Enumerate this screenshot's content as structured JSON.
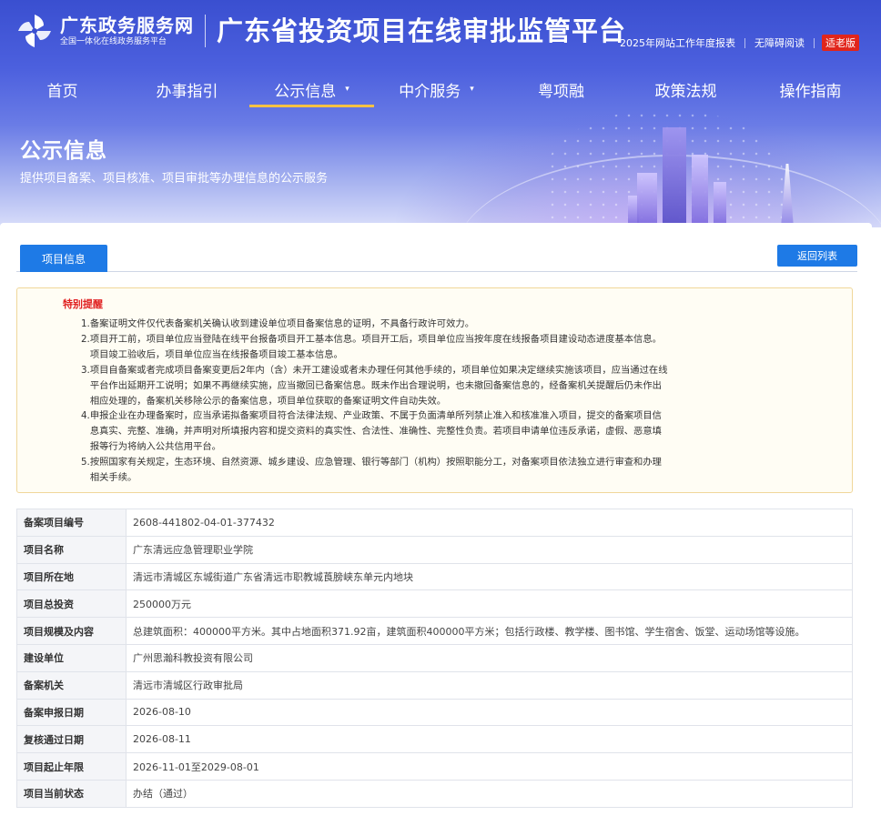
{
  "header": {
    "logo_name": "广东政务服务网",
    "logo_sub": "全国一体化在线政务服务平台",
    "platform_title": "广东省投资项目在线审批监管平台",
    "links": [
      "2025年网站工作年度报表",
      "无障碍阅读"
    ],
    "elder_label": "适老版"
  },
  "nav": {
    "items": [
      {
        "label": "首页",
        "has_dropdown": false
      },
      {
        "label": "办事指引",
        "has_dropdown": false
      },
      {
        "label": "公示信息",
        "has_dropdown": true,
        "active": true
      },
      {
        "label": "中介服务",
        "has_dropdown": true
      },
      {
        "label": "粤项融",
        "has_dropdown": false
      },
      {
        "label": "政策法规",
        "has_dropdown": false
      },
      {
        "label": "操作指南",
        "has_dropdown": false
      }
    ],
    "caret_icon": "▾"
  },
  "banner": {
    "title": "公示信息",
    "subtitle": "提供项目备案、项目核准、项目审批等办理信息的公示服务"
  },
  "tabs": {
    "active_label": "项目信息",
    "back_label": "返回列表"
  },
  "notice": {
    "title": "特别提醒",
    "items": [
      {
        "num": "1.",
        "lines": [
          "备案证明文件仅代表备案机关确认收到建设单位项目备案信息的证明，不具备行政许可效力。"
        ]
      },
      {
        "num": "2.",
        "lines": [
          "项目开工前，项目单位应当登陆在线平台报备项目开工基本信息。项目开工后，项目单位应当按年度在线报备项目建设动态进度基本信息。",
          "项目竣工验收后，项目单位应当在线报备项目竣工基本信息。"
        ]
      },
      {
        "num": "3.",
        "lines": [
          "项目自备案或者完成项目备案变更后2年内（含）未开工建设或者未办理任何其他手续的，项目单位如果决定继续实施该项目，应当通过在线",
          "平台作出延期开工说明；如果不再继续实施，应当撤回已备案信息。既未作出合理说明，也未撤回备案信息的，经备案机关提醒后仍未作出",
          "相应处理的，备案机关移除公示的备案信息，项目单位获取的备案证明文件自动失效。"
        ]
      },
      {
        "num": "4.",
        "lines": [
          "申报企业在办理备案时，应当承诺拟备案项目符合法律法规、产业政策、不属于负面清单所列禁止准入和核准准入项目，提交的备案项目信",
          "息真实、完整、准确，并声明对所填报内容和提交资料的真实性、合法性、准确性、完整性负责。若项目申请单位违反承诺，虚假、恶意填",
          "报等行为将纳入公共信用平台。"
        ]
      },
      {
        "num": "5.",
        "lines": [
          "按照国家有关规定，生态环境、自然资源、城乡建设、应急管理、银行等部门（机构）按照职能分工，对备案项目依法独立进行审查和办理",
          "相关手续。"
        ]
      }
    ]
  },
  "project": {
    "rows": [
      {
        "key": "备案项目编号",
        "value": "2608-441802-04-01-377432"
      },
      {
        "key": "项目名称",
        "value": "广东清远应急管理职业学院"
      },
      {
        "key": "项目所在地",
        "value": "清远市清城区东城街道广东省清远市职教城莨膀峡东单元内地块"
      },
      {
        "key": "项目总投资",
        "value": "250000万元"
      },
      {
        "key": "项目规模及内容",
        "value": "总建筑面积：400000平方米。其中占地面积371.92亩，建筑面积400000平方米；包括行政楼、教学楼、图书馆、学生宿舍、饭堂、运动场馆等设施。"
      },
      {
        "key": "建设单位",
        "value": "广州思瀚科教投资有限公司"
      },
      {
        "key": "备案机关",
        "value": "清远市清城区行政审批局"
      },
      {
        "key": "备案申报日期",
        "value": "2026-08-10"
      },
      {
        "key": "复核通过日期",
        "value": "2026-08-11"
      },
      {
        "key": "项目起止年限",
        "value": "2026-11-01至2029-08-01"
      },
      {
        "key": "项目当前状态",
        "value": "办结（通过）"
      }
    ]
  },
  "colors": {
    "primary": "#1e7ae6",
    "nav_active": "#f6c244",
    "notice_title": "#e02020",
    "elder_badge": "#e1251b"
  }
}
